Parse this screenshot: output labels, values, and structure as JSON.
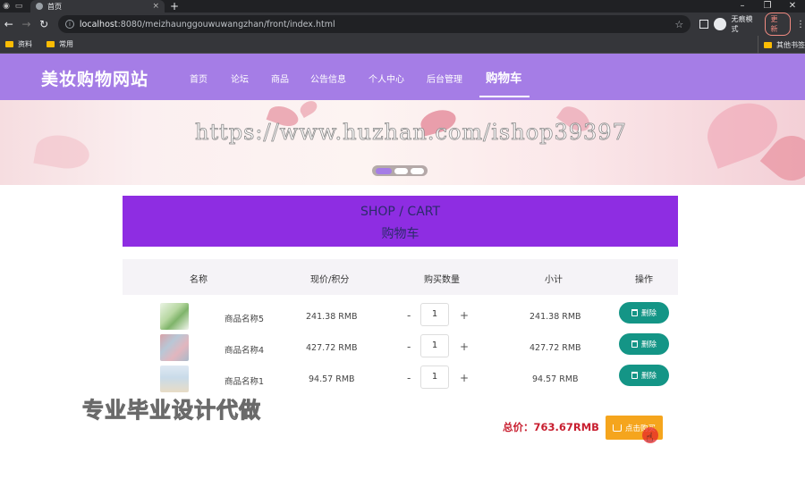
{
  "browser": {
    "tab_title": "首页",
    "url_host": "localhost",
    "url_rest": ":8080/meizhaunggouwuwangzhan/front/index.html",
    "incognito_label": "无痕模式",
    "update_label": "更新",
    "new_tab": "+",
    "bookmarks": [
      "资料",
      "常用"
    ],
    "other_bookmarks": "其他书签"
  },
  "header": {
    "logo": "美妆购物网站",
    "nav": [
      "首页",
      "论坛",
      "商品",
      "公告信息",
      "个人中心",
      "后台管理",
      "购物车"
    ],
    "active_nav": "购物车"
  },
  "banner": {
    "watermark": "https://www.huzhan.com/ishop39397"
  },
  "cart": {
    "title_en": "SHOP / CART",
    "title_cn": "购物车",
    "columns": [
      "名称",
      "现价/积分",
      "购买数量",
      "小计",
      "操作"
    ],
    "items": [
      {
        "name": "商品名称5",
        "price": "241.38 RMB",
        "qty": "1",
        "subtotal": "241.38 RMB",
        "action": "删除"
      },
      {
        "name": "商品名称4",
        "price": "427.72 RMB",
        "qty": "1",
        "subtotal": "427.72 RMB",
        "action": "删除"
      },
      {
        "name": "商品名称1",
        "price": "94.57 RMB",
        "qty": "1",
        "subtotal": "94.57 RMB",
        "action": "删除"
      }
    ],
    "qty_minus": "-",
    "qty_plus": "+",
    "total": "总价：763.67RMB",
    "checkout_label": "点击购买"
  },
  "overlay_text": "专业毕业设计代做",
  "colors": {
    "header_bg": "#a57de6",
    "title_bg": "#8e2de2",
    "delete_btn": "#149586",
    "checkout_btn": "#f5a51d",
    "total_text": "#c81e2f"
  }
}
